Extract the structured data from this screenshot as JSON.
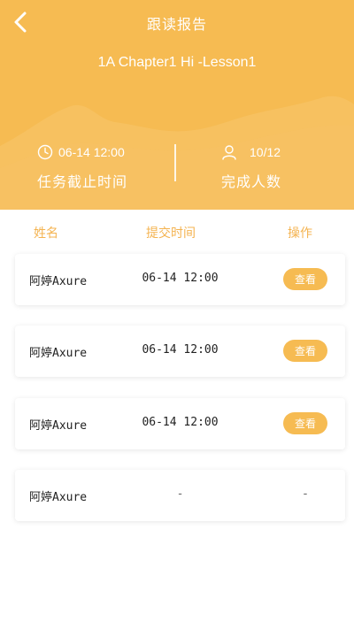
{
  "nav": {
    "title": "跟读报告"
  },
  "lesson": {
    "title": "1A Chapter1 Hi -Lesson1"
  },
  "stats": {
    "deadline_value": "06-14 12:00",
    "deadline_label": "任务截止时间",
    "completion_value": "10/12",
    "completion_label": "完成人数"
  },
  "columns": {
    "name": "姓名",
    "time": "提交时间",
    "action": "操作"
  },
  "rows": [
    {
      "name": "阿婷Axure",
      "time": "06-14 12:00",
      "action": "查看"
    },
    {
      "name": "阿婷Axure",
      "time": "06-14 12:00",
      "action": "查看"
    },
    {
      "name": "阿婷Axure",
      "time": "06-14 12:00",
      "action": "查看"
    },
    {
      "name": "阿婷Axure",
      "time": "-",
      "action": "-"
    }
  ],
  "colors": {
    "accent": "#f6bb52",
    "header_text": "#ffffff",
    "column_header": "#f4b350"
  },
  "icons": {
    "back": "chevron-left-icon",
    "deadline": "clock-icon",
    "completion": "person-icon"
  }
}
